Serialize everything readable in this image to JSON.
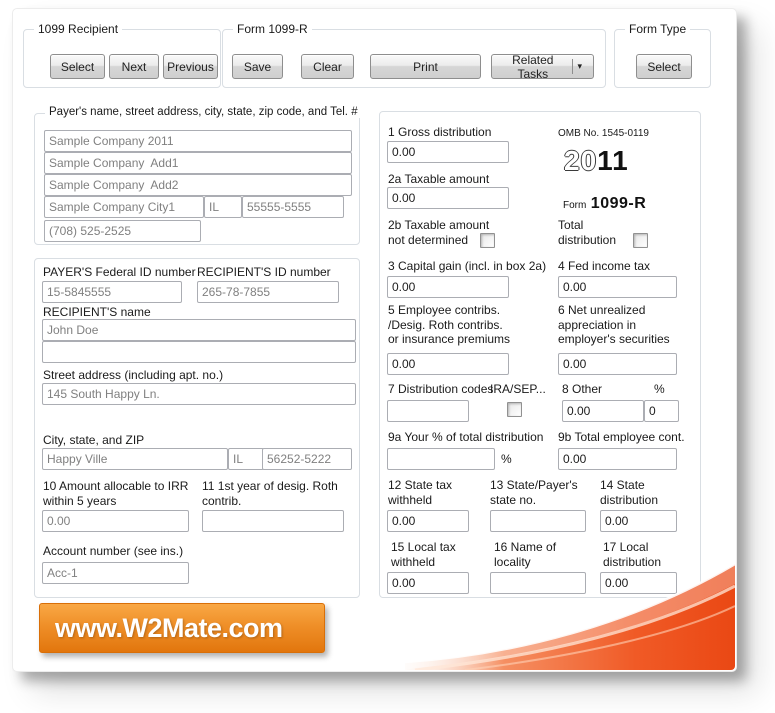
{
  "toolbar": {
    "recipient_group": {
      "title": "1099 Recipient",
      "select_label": "Select",
      "next_label": "Next",
      "previous_label": "Previous"
    },
    "form_group": {
      "title": "Form 1099-R",
      "save_label": "Save",
      "clear_label": "Clear",
      "print_label": "Print",
      "related_tasks_label": "Related Tasks",
      "dropdown_glyph": "▾"
    },
    "type_group": {
      "title": "Form Type",
      "select_label": "Select"
    }
  },
  "payer": {
    "group_title": "Payer's name, street address, city, state, zip code, and Tel. #",
    "name": "Sample Company 2011",
    "address1": "Sample Company  Add1",
    "address2": "Sample Company  Add2",
    "city": "Sample Company City1",
    "state": "IL",
    "zip": "55555-5555",
    "phone": "(708) 525-2525"
  },
  "recipient": {
    "payer_fed_id_label": "PAYER'S Federal ID number",
    "payer_fed_id": "15-5845555",
    "recipient_id_label": "RECIPIENT'S ID number",
    "recipient_id": "265-78-7855",
    "name_label": "RECIPIENT'S name",
    "name": "John Doe",
    "name_line2": "",
    "street_label": "Street address (including apt. no.)",
    "street": "145 South Happy Ln.",
    "city_label": "City, state, and ZIP",
    "city": "Happy Ville",
    "state": "IL",
    "zip": "56252-5222",
    "box10_label": "10 Amount allocable to IRR\nwithin 5 years",
    "box10_value": "0.00",
    "box11_label": "11 1st year of desig. Roth\ncontrib.",
    "box11_value": "",
    "account_label": "Account number (see ins.)",
    "account_value": "Acc-1"
  },
  "form1099r": {
    "omb_label": "OMB No. 1545-0119",
    "year_outline": "20",
    "year_solid": "11",
    "form_word": "Form",
    "form_number": "1099-R",
    "percent_sign": "%",
    "box1_label": "1 Gross distribution",
    "box1_value": "0.00",
    "box2a_label": "2a Taxable amount",
    "box2a_value": "0.00",
    "box2b_label": "2b Taxable amount\nnot determined",
    "total_dist_label": "Total\ndistribution",
    "box3_label": "3 Capital gain (incl. in box 2a)",
    "box3_value": "0.00",
    "box4_label": "4 Fed income tax",
    "box4_value": "0.00",
    "box5_label": "5 Employee contribs.\n/Desig. Roth contribs.\nor insurance premiums",
    "box5_value": "0.00",
    "box6_label": "6 Net unrealized\nappreciation in\nemployer's securities",
    "box6_value": "0.00",
    "box7_label": "7 Distribution codes",
    "box7_value": "",
    "ira_sep_label": "IRA/SEP...",
    "box8_label": "8 Other",
    "box8_value": "0.00",
    "box8_pct_value": "0",
    "box9a_label": "9a Your % of total distribution",
    "box9a_value": "",
    "box9b_label": "9b Total employee cont.",
    "box9b_value": "0.00",
    "box12_label": "12 State tax\nwithheld",
    "box12_value": "0.00",
    "box13_label": "13 State/Payer's\nstate no.",
    "box13_value": "",
    "box14_label": "14 State\ndistribution",
    "box14_value": "0.00",
    "box15_label": "15 Local tax\nwithheld",
    "box15_value": "0.00",
    "box16_label": "16 Name of\nlocality",
    "box16_value": "",
    "box17_label": "17 Local\ndistribution",
    "box17_value": "0.00"
  },
  "banner": {
    "url_text": "www.W2Mate.com"
  },
  "colors": {
    "banner_orange": "#ee8419",
    "swoosh_orange": "#ef4e1d"
  }
}
